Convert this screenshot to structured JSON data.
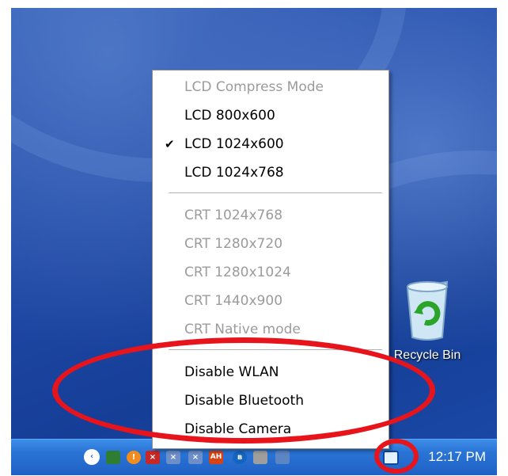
{
  "menu": {
    "items": [
      {
        "label": "LCD Compress Mode",
        "enabled": false,
        "checked": false
      },
      {
        "label": "LCD 800x600",
        "enabled": true,
        "checked": false
      },
      {
        "label": "LCD 1024x600",
        "enabled": true,
        "checked": true
      },
      {
        "label": "LCD 1024x768",
        "enabled": true,
        "checked": false
      },
      {
        "label": "CRT 1024x768",
        "enabled": false,
        "checked": false
      },
      {
        "label": "CRT 1280x720",
        "enabled": false,
        "checked": false
      },
      {
        "label": "CRT 1280x1024",
        "enabled": false,
        "checked": false
      },
      {
        "label": "CRT 1440x900",
        "enabled": false,
        "checked": false
      },
      {
        "label": "CRT Native mode",
        "enabled": false,
        "checked": false
      },
      {
        "label": "Disable WLAN",
        "enabled": true,
        "checked": false
      },
      {
        "label": "Disable Bluetooth",
        "enabled": true,
        "checked": false
      },
      {
        "label": "Disable Camera",
        "enabled": true,
        "checked": false
      }
    ],
    "check_glyph": "✔"
  },
  "desktop": {
    "recycle_bin_label": "Recycle Bin"
  },
  "taskbar": {
    "clock": "12:17 PM",
    "tray_icons": [
      "show-hidden-icons-arrow",
      "network-icon",
      "security-alert-icon",
      "volume-muted-icon",
      "network-disconnected-icon",
      "network-disconnected-icon",
      "ah-icon",
      "bluetooth-icon",
      "network-icon",
      "display-icon",
      "display-mode-utility-icon"
    ]
  },
  "annotation": {
    "color": "#e8141c"
  }
}
